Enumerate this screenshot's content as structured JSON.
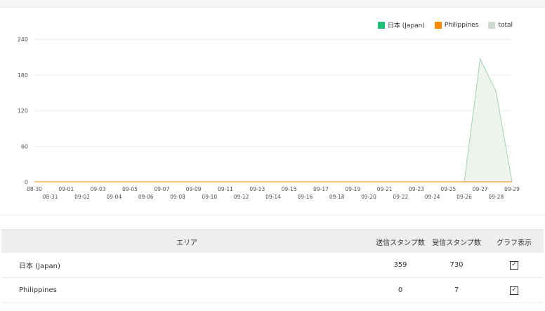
{
  "chart_data": {
    "type": "area",
    "ylim": [
      0,
      240
    ],
    "yticks": [
      "0",
      "60",
      "120",
      "180",
      "240"
    ],
    "x": [
      "08-30",
      "08-31",
      "09-01",
      "09-02",
      "09-03",
      "09-04",
      "09-05",
      "09-06",
      "09-07",
      "09-08",
      "09-09",
      "09-10",
      "09-11",
      "09-12",
      "09-13",
      "09-14",
      "09-15",
      "09-16",
      "09-17",
      "09-18",
      "09-19",
      "09-20",
      "09-21",
      "09-22",
      "09-23",
      "09-24",
      "09-25",
      "09-26",
      "09-27",
      "09-28",
      "09-29"
    ],
    "series": [
      {
        "name": "日本 (Japan)",
        "color": "#1ec178",
        "values": [
          0,
          0,
          0,
          0,
          0,
          0,
          0,
          0,
          0,
          0,
          0,
          0,
          0,
          0,
          0,
          0,
          0,
          0,
          0,
          0,
          0,
          0,
          0,
          0,
          0,
          0,
          0,
          0,
          0,
          0,
          0
        ]
      },
      {
        "name": "Philippines",
        "color": "#ff8a00",
        "values": [
          0,
          0,
          0,
          0,
          0,
          0,
          0,
          0,
          0,
          0,
          0,
          0,
          0,
          0,
          0,
          0,
          0,
          0,
          0,
          0,
          0,
          0,
          0,
          0,
          0,
          0,
          0,
          0,
          0,
          0,
          0
        ]
      },
      {
        "name": "total",
        "color": "#cfd9cf",
        "values": [
          0,
          0,
          0,
          0,
          0,
          0,
          0,
          0,
          0,
          0,
          0,
          0,
          0,
          0,
          0,
          0,
          0,
          0,
          0,
          0,
          0,
          0,
          0,
          0,
          0,
          0,
          0,
          0,
          207,
          152,
          0
        ]
      }
    ],
    "legend_position": "top-right",
    "grid": true
  },
  "table": {
    "headers": {
      "area": "エリア",
      "sent": "送信スタンプ数",
      "received": "受信スタンプ数",
      "graph": "グラフ表示"
    },
    "rows": [
      {
        "area": "日本 (Japan)",
        "sent": "359",
        "received": "730",
        "checked": "✓"
      },
      {
        "area": "Philippines",
        "sent": "0",
        "received": "7",
        "checked": "✓"
      }
    ]
  }
}
